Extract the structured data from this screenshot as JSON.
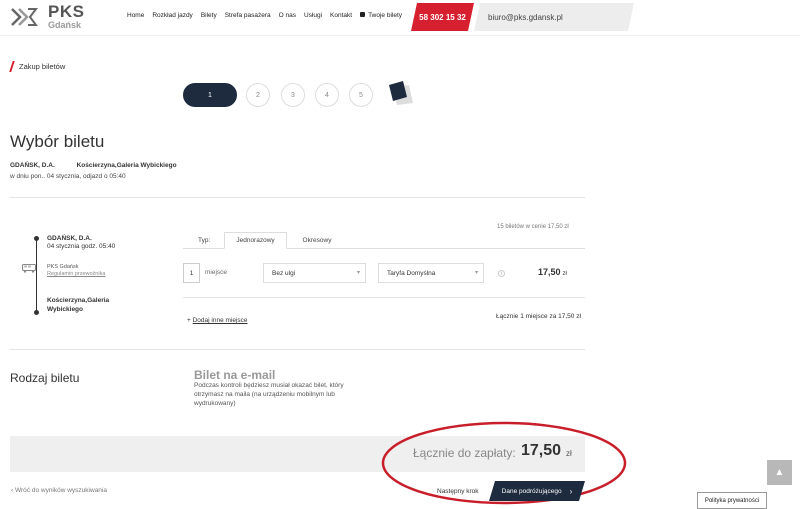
{
  "header": {
    "logo_text": "PKS",
    "logo_city": "Gdańsk",
    "nav": [
      "Home",
      "Rozkład jazdy",
      "Bilety",
      "Strefa pasażera",
      "O nas",
      "Usługi",
      "Kontakt",
      "Twoje bilety"
    ],
    "phone": "58 302 15 32",
    "email": "biuro@pks.gdansk.pl"
  },
  "breadcrumb": "Zakup biletów",
  "steps": [
    "1",
    "2",
    "3",
    "4",
    "5"
  ],
  "title": "Wybór biletu",
  "route": {
    "from": "GDAŃSK, D.A.",
    "to": "Kościerzyna,Galeria Wybickiego",
    "date_text": "w dniu pon.. 04 stycznia, odjazd o 05:40"
  },
  "timeline": {
    "from": "GDAŃSK, D.A.",
    "from_date": "04 stycznia godz. 05:40",
    "carrier": "PKS Gdańsk",
    "carrier_link": "Regulamin przewoźnika",
    "to": "Kościerzyna,Galeria Wybickiego"
  },
  "ticket": {
    "count_info": "15 biletów w cenie 17,50 zł",
    "type_label": "Typ:",
    "tabs": [
      "Jednorazowy",
      "Okresowy"
    ],
    "qty": "1",
    "qty_label": "miejsce",
    "discount": "Bez ulgi",
    "tariff": "Taryfa Domyślna",
    "price": "17,50",
    "currency": "zł",
    "add_seat": "Dodaj inne miejsce",
    "sum_line": "Łącznie 1 miejsce za 17,50 zł"
  },
  "ticket_kind": {
    "label": "Rodzaj biletu",
    "title": "Bilet na e-mail",
    "desc": "Podczas kontroli będziesz musiał okazać bilet, który otrzymasz na maila (na urządzeniu mobilnym lub wydrukowany)"
  },
  "total": {
    "label": "Łącznie do zapłaty:",
    "value": "17,50",
    "currency": "zł"
  },
  "bottom": {
    "back": "Wróć do wyników wyszukiwania",
    "next_label": "Następny krok",
    "next_button": "Dane podróżującego",
    "privacy": "Polityka prywatności"
  },
  "colors": {
    "brand_red": "#d6202f",
    "navy": "#1e2a3e"
  }
}
